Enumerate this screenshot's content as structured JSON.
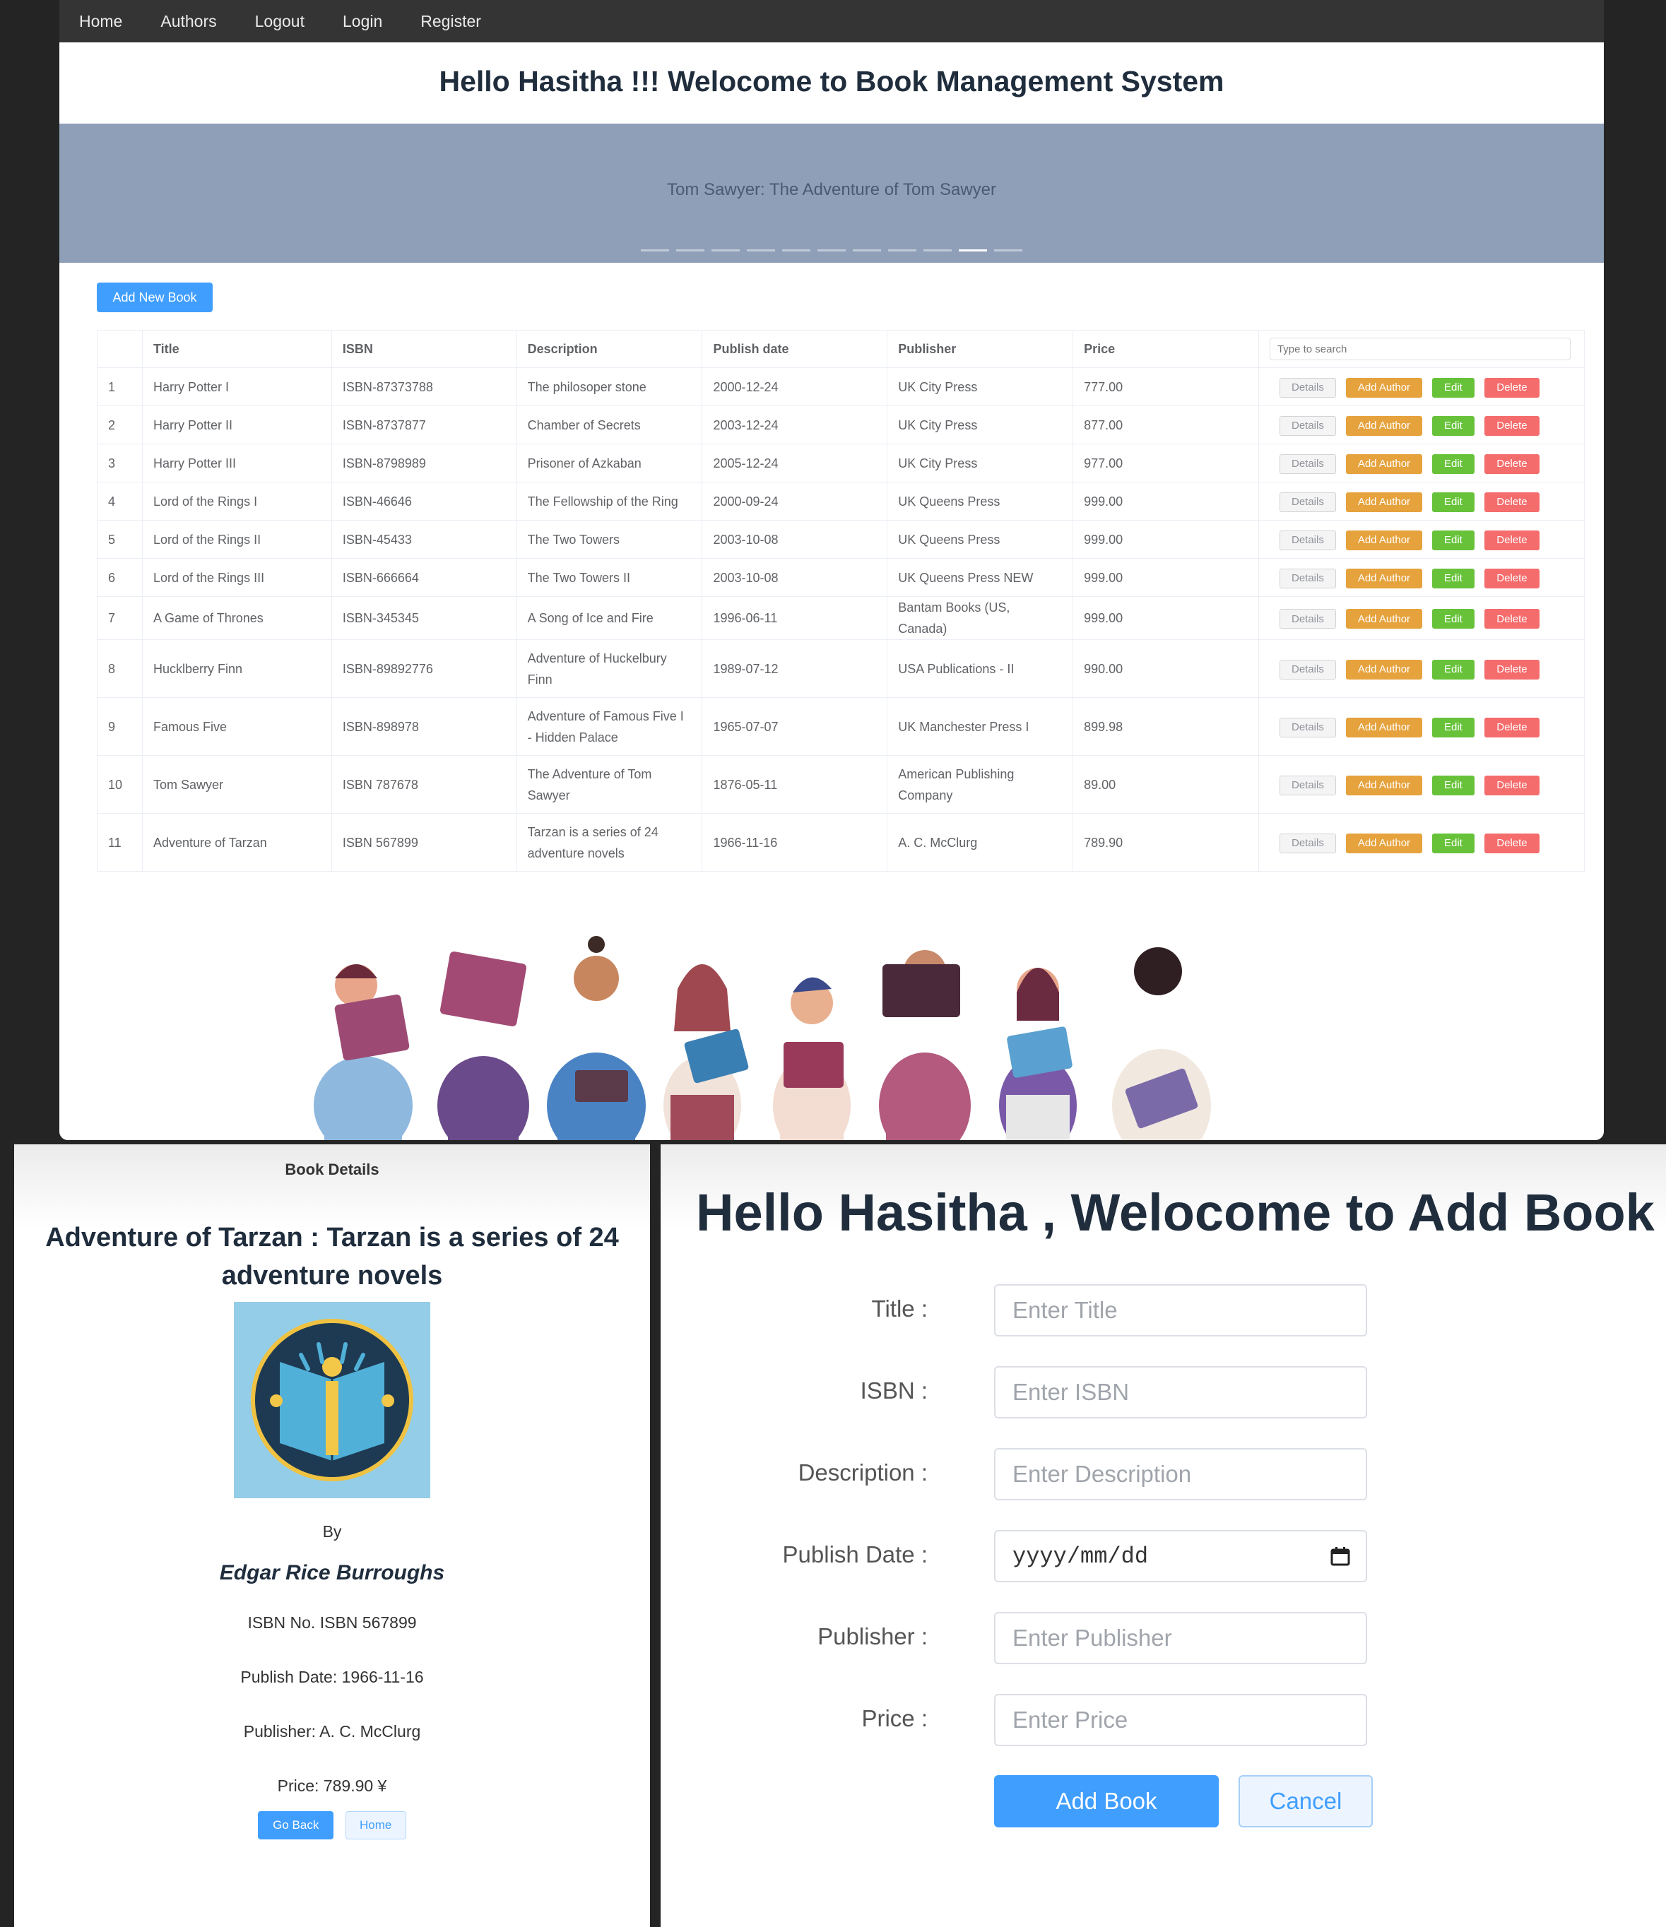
{
  "nav": {
    "items": [
      "Home",
      "Authors",
      "Logout",
      "Login",
      "Register"
    ]
  },
  "header": {
    "welcome": "Hello Hasitha !!! Welocome to Book Management System"
  },
  "carousel": {
    "caption": "Tom Sawyer: The Adventure of Tom Sawyer",
    "slide_count": 11,
    "active_index": 9
  },
  "toolbar": {
    "add_new_book": "Add New Book"
  },
  "table": {
    "headers": [
      "",
      "Title",
      "ISBN",
      "Description",
      "Publish date",
      "Publisher",
      "Price"
    ],
    "search_placeholder": "Type to search",
    "action_labels": {
      "details": "Details",
      "add_author": "Add Author",
      "edit": "Edit",
      "delete": "Delete"
    },
    "rows": [
      [
        "1",
        "Harry Potter I",
        "ISBN-87373788",
        "The philosoper stone",
        "2000-12-24",
        "UK City Press",
        "777.00"
      ],
      [
        "2",
        "Harry Potter II",
        "ISBN-8737877",
        "Chamber of Secrets",
        "2003-12-24",
        "UK City Press",
        "877.00"
      ],
      [
        "3",
        "Harry Potter III",
        "ISBN-8798989",
        "Prisoner of Azkaban",
        "2005-12-24",
        "UK City Press",
        "977.00"
      ],
      [
        "4",
        "Lord of the Rings I",
        "ISBN-46646",
        "The Fellowship of the Ring",
        "2000-09-24",
        "UK Queens Press",
        "999.00"
      ],
      [
        "5",
        "Lord of the Rings II",
        "ISBN-45433",
        "The Two Towers",
        "2003-10-08",
        "UK Queens Press",
        "999.00"
      ],
      [
        "6",
        "Lord of the Rings III",
        "ISBN-666664",
        "The Two Towers II",
        "2003-10-08",
        "UK Queens Press NEW",
        "999.00"
      ],
      [
        "7",
        "A Game of Thrones",
        "ISBN-345345",
        "A Song of Ice and Fire",
        "1996-06-11",
        "Bantam Books (US, Canada)",
        "999.00"
      ],
      [
        "8",
        "Hucklberry Finn",
        "ISBN-89892776",
        "Adventure of Huckelbury Finn",
        "1989-07-12",
        "USA Publications - II",
        "990.00"
      ],
      [
        "9",
        "Famous Five",
        "ISBN-898978",
        "Adventure of Famous Five I - Hidden Palace",
        "1965-07-07",
        "UK Manchester Press I",
        "899.98"
      ],
      [
        "10",
        "Tom Sawyer",
        "ISBN 787678",
        "The Adventure of Tom Sawyer",
        "1876-05-11",
        "American Publishing Company",
        "89.00"
      ],
      [
        "11",
        "Adventure of Tarzan",
        "ISBN 567899",
        "Tarzan is a series of 24 adventure novels",
        "1966-11-16",
        "A. C. McClurg",
        "789.90"
      ]
    ]
  },
  "details": {
    "header": "Book Details",
    "title": "Adventure of Tarzan : Tarzan is a series of 24 adventure novels",
    "by": "By",
    "author": "Edgar Rice Burroughs",
    "isbn": "ISBN No. ISBN 567899",
    "publish_date": "Publish Date: 1966-11-16",
    "publisher": "Publisher: A. C. McClurg",
    "price": "Price: 789.90 ¥",
    "go_back": "Go Back",
    "home": "Home",
    "cover_icon": "book-reader-icon"
  },
  "add_book": {
    "title": "Hello Hasitha , Welocome to Add Book",
    "fields": [
      {
        "label": "Title :",
        "placeholder": "Enter Title"
      },
      {
        "label": "ISBN :",
        "placeholder": "Enter ISBN"
      },
      {
        "label": "Description :",
        "placeholder": "Enter Description"
      },
      {
        "label": "Publish Date :",
        "placeholder": "yyyy/mm/dd"
      },
      {
        "label": "Publisher :",
        "placeholder": "Enter Publisher"
      },
      {
        "label": "Price :",
        "placeholder": "Enter Price"
      }
    ],
    "submit": "Add Book",
    "cancel": "Cancel"
  },
  "colors": {
    "primary": "#409eff",
    "warning": "#e6a23c",
    "success": "#67c23a",
    "danger": "#f56c6c",
    "carousel_bg": "#8f9fb8",
    "navbar": "#343434"
  }
}
